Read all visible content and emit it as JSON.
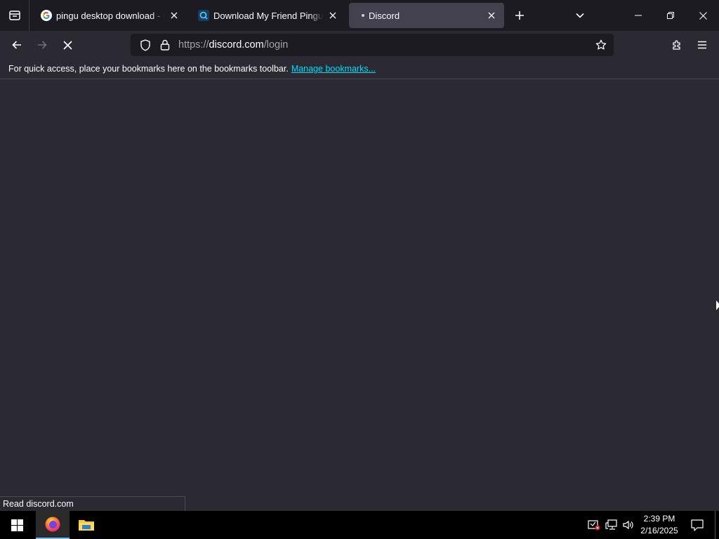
{
  "browser": {
    "tabs": [
      {
        "title": "pingu desktop download - Goo",
        "favicon": "google-g-icon",
        "active": false
      },
      {
        "title": "Download My Friend Pingu by",
        "favicon": "search-favicon-icon",
        "active": false
      },
      {
        "title": "Discord",
        "favicon": "loading-dot",
        "active": true
      }
    ],
    "url": {
      "scheme": "https://",
      "host": "discord.com",
      "path": "/login"
    },
    "bookmarks_bar": {
      "message": "For quick access, place your bookmarks here on the bookmarks toolbar.",
      "link_label": "Manage bookmarks..."
    },
    "status_text": "Read discord.com",
    "accent_link_color": "#00ddff"
  },
  "taskbar": {
    "apps": [
      {
        "name": "Firefox",
        "icon": "firefox-icon",
        "active": true
      },
      {
        "name": "File Explorer",
        "icon": "folder-icon",
        "active": false
      }
    ],
    "clock": {
      "time": "2:39 PM",
      "date": "2/16/2025"
    }
  }
}
